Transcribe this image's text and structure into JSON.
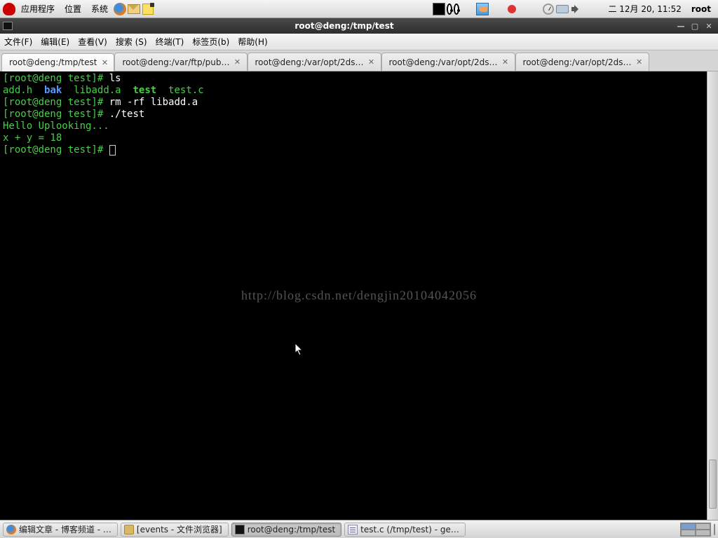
{
  "top_panel": {
    "menus": {
      "apps": "应用程序",
      "places": "位置",
      "system": "系统"
    },
    "clock": "二 12月 20, 11:52",
    "user": "root"
  },
  "window": {
    "title": "root@deng:/tmp/test",
    "menus": {
      "file": "文件(F)",
      "edit": "编辑(E)",
      "view": "查看(V)",
      "search": "搜索 (S)",
      "terminal": "终端(T)",
      "tabs": "标签页(b)",
      "help": "帮助(H)"
    },
    "tabs": [
      {
        "label": "root@deng:/tmp/test",
        "active": true
      },
      {
        "label": "root@deng:/var/ftp/pub…",
        "active": false
      },
      {
        "label": "root@deng:/var/opt/2ds…",
        "active": false
      },
      {
        "label": "root@deng:/var/opt/2ds…",
        "active": false
      },
      {
        "label": "root@deng:/var/opt/2ds…",
        "active": false
      }
    ]
  },
  "terminal": {
    "prompt": "[root@deng test]#",
    "cmd1": "ls",
    "files": {
      "addh": "add.h",
      "bak": "bak",
      "libadd": "libadd.a",
      "test": "test",
      "testc": "test.c"
    },
    "cmd2": "rm -rf libadd.a",
    "cmd3": "./test",
    "out1": "Hello Uplooking...",
    "out2": "x + y = 18",
    "watermark": "http://blog.csdn.net/dengjin20104042056"
  },
  "taskbar": {
    "items": [
      {
        "label": "编辑文章 - 博客频道 - …",
        "icon": "ff",
        "active": false
      },
      {
        "label": "[events - 文件浏览器]",
        "icon": "folder",
        "active": false
      },
      {
        "label": "root@deng:/tmp/test",
        "icon": "term",
        "active": true
      },
      {
        "label": "test.c (/tmp/test) - ge…",
        "icon": "gedit",
        "active": false
      }
    ]
  }
}
